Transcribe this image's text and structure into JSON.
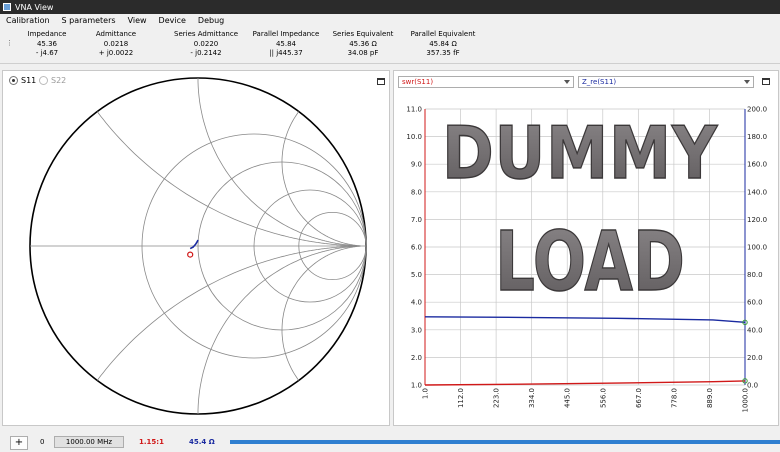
{
  "window": {
    "title": "VNA View"
  },
  "menu": [
    "Calibration",
    "S parameters",
    "View",
    "Device",
    "Debug"
  ],
  "values": {
    "impedance": {
      "label": "Impedance",
      "line1": "45.36",
      "line2": "- j4.67"
    },
    "admittance": {
      "label": "Admittance",
      "line1": "0.0218",
      "line2": "+ j0.0022"
    },
    "series_admittance": {
      "label": "Series Admittance",
      "line1": "0.0220",
      "line2": "- j0.2142"
    },
    "parallel_impedance": {
      "label": "Parallel Impedance",
      "line1": "45.84",
      "line2": "|| j445.37"
    },
    "series_equivalent": {
      "label": "Series Equivalent",
      "line1": "45.36 Ω",
      "line2": "34.08 pF"
    },
    "parallel_equivalent": {
      "label": "Parallel Equivalent",
      "line1": "45.84 Ω",
      "line2": "357.35 fF"
    }
  },
  "smith": {
    "s11_label": "S11",
    "s22_label": "S22",
    "s11_selected": true,
    "trace_color": "#1a2aa0",
    "marker_color": "#d01818"
  },
  "chart_panel": {
    "combo_left": "swr(S11)",
    "combo_right": "Z_re(S11)",
    "overlay_line1": "DUMMY",
    "overlay_line2": "LOAD"
  },
  "chart_data": {
    "type": "line",
    "x": [
      1.0,
      1000.0
    ],
    "xlim": [
      1.0,
      1000.0
    ],
    "x_ticks": [
      "1.0",
      "112.0",
      "223.0",
      "334.0",
      "445.0",
      "556.0",
      "667.0",
      "778.0",
      "889.0",
      "1000.0"
    ],
    "ylim_left": [
      1.0,
      11.0
    ],
    "y_ticks_left": [
      "11.0",
      "10.0",
      "9.0",
      "8.0",
      "7.0",
      "6.0",
      "5.0",
      "4.0",
      "3.0",
      "2.0",
      "1.0"
    ],
    "ylim_right": [
      0.0,
      200.0
    ],
    "y_ticks_right": [
      "200.0",
      "180.0",
      "160.0",
      "140.0",
      "120.0",
      "100.0",
      "80.0",
      "60.0",
      "40.0",
      "20.0",
      "0.0"
    ],
    "grid": true,
    "series": [
      {
        "axis": "left",
        "color": "#d01818",
        "x": [
          1.0,
          300.0,
          600.0,
          900.0,
          1000.0
        ],
        "values": [
          1.0,
          1.03,
          1.07,
          1.12,
          1.15
        ]
      },
      {
        "axis": "right",
        "color": "#1a2aa0",
        "x": [
          1.0,
          300.0,
          600.0,
          900.0,
          1000.0
        ],
        "values": [
          49.4,
          49.0,
          48.3,
          47.2,
          45.4
        ]
      }
    ],
    "left_axis_color": "#d01818",
    "right_axis_color": "#1a2aa0"
  },
  "bottom": {
    "add_label": "+",
    "marker_index": "0",
    "frequency": "1000.00 MHz",
    "swr": "1.15:1",
    "impedance": "45.4 Ω"
  }
}
